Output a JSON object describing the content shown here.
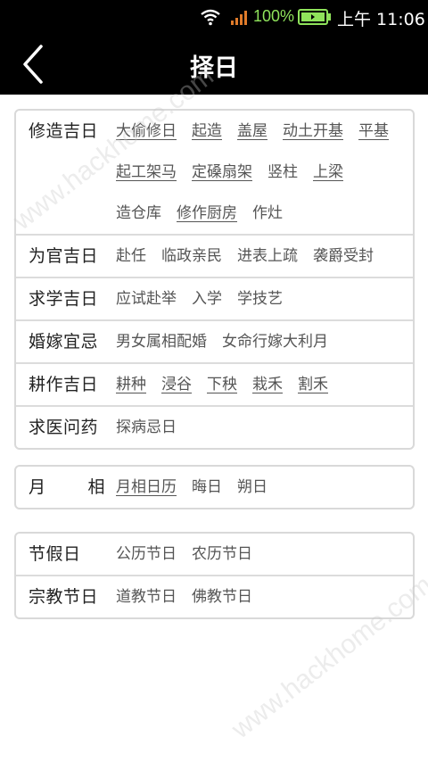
{
  "status": {
    "battery_pct": "100%",
    "time": "上午 11:06"
  },
  "header": {
    "title": "择日"
  },
  "sections": [
    {
      "rows": [
        {
          "label": "修造吉日",
          "items": [
            {
              "text": "大偷修日",
              "link": true
            },
            {
              "text": "起造",
              "link": true
            },
            {
              "text": "盖屋",
              "link": true
            },
            {
              "text": "动土开基",
              "link": true
            },
            {
              "text": "平基",
              "link": true
            },
            {
              "text": "起工架马",
              "link": true
            },
            {
              "text": "定磉扇架",
              "link": true
            },
            {
              "text": "竖柱",
              "link": false
            },
            {
              "text": "上梁",
              "link": true
            },
            {
              "text": "造仓库",
              "link": false
            },
            {
              "text": "修作厨房",
              "link": true
            },
            {
              "text": "作灶",
              "link": false
            }
          ]
        },
        {
          "label": "为官吉日",
          "items": [
            {
              "text": "赴任",
              "link": false
            },
            {
              "text": "临政亲民",
              "link": false
            },
            {
              "text": "进表上疏",
              "link": false
            },
            {
              "text": "袭爵受封",
              "link": false
            }
          ]
        },
        {
          "label": "求学吉日",
          "items": [
            {
              "text": "应试赴举",
              "link": false
            },
            {
              "text": "入学",
              "link": false
            },
            {
              "text": "学技艺",
              "link": false
            }
          ]
        },
        {
          "label": "婚嫁宜忌",
          "items": [
            {
              "text": "男女属相配婚",
              "link": false
            },
            {
              "text": "女命行嫁大利月",
              "link": false
            }
          ]
        },
        {
          "label": "耕作吉日",
          "items": [
            {
              "text": "耕种",
              "link": true
            },
            {
              "text": "浸谷",
              "link": true
            },
            {
              "text": "下秧",
              "link": true
            },
            {
              "text": "栽禾",
              "link": true
            },
            {
              "text": "割禾",
              "link": true
            }
          ]
        },
        {
          "label": "求医问药",
          "items": [
            {
              "text": "探病忌日",
              "link": false
            }
          ]
        }
      ]
    },
    {
      "rows": [
        {
          "label": "月相",
          "spread": true,
          "items": [
            {
              "text": "月相日历",
              "link": true
            },
            {
              "text": "晦日",
              "link": false
            },
            {
              "text": "朔日",
              "link": false
            }
          ]
        }
      ]
    },
    {
      "rows": [
        {
          "label": "节假日",
          "items": [
            {
              "text": "公历节日",
              "link": false
            },
            {
              "text": "农历节日",
              "link": false
            }
          ]
        },
        {
          "label": "宗教节日",
          "items": [
            {
              "text": "道教节日",
              "link": false
            },
            {
              "text": "佛教节日",
              "link": false
            }
          ]
        }
      ]
    }
  ],
  "watermark": "www.hackhome.com"
}
